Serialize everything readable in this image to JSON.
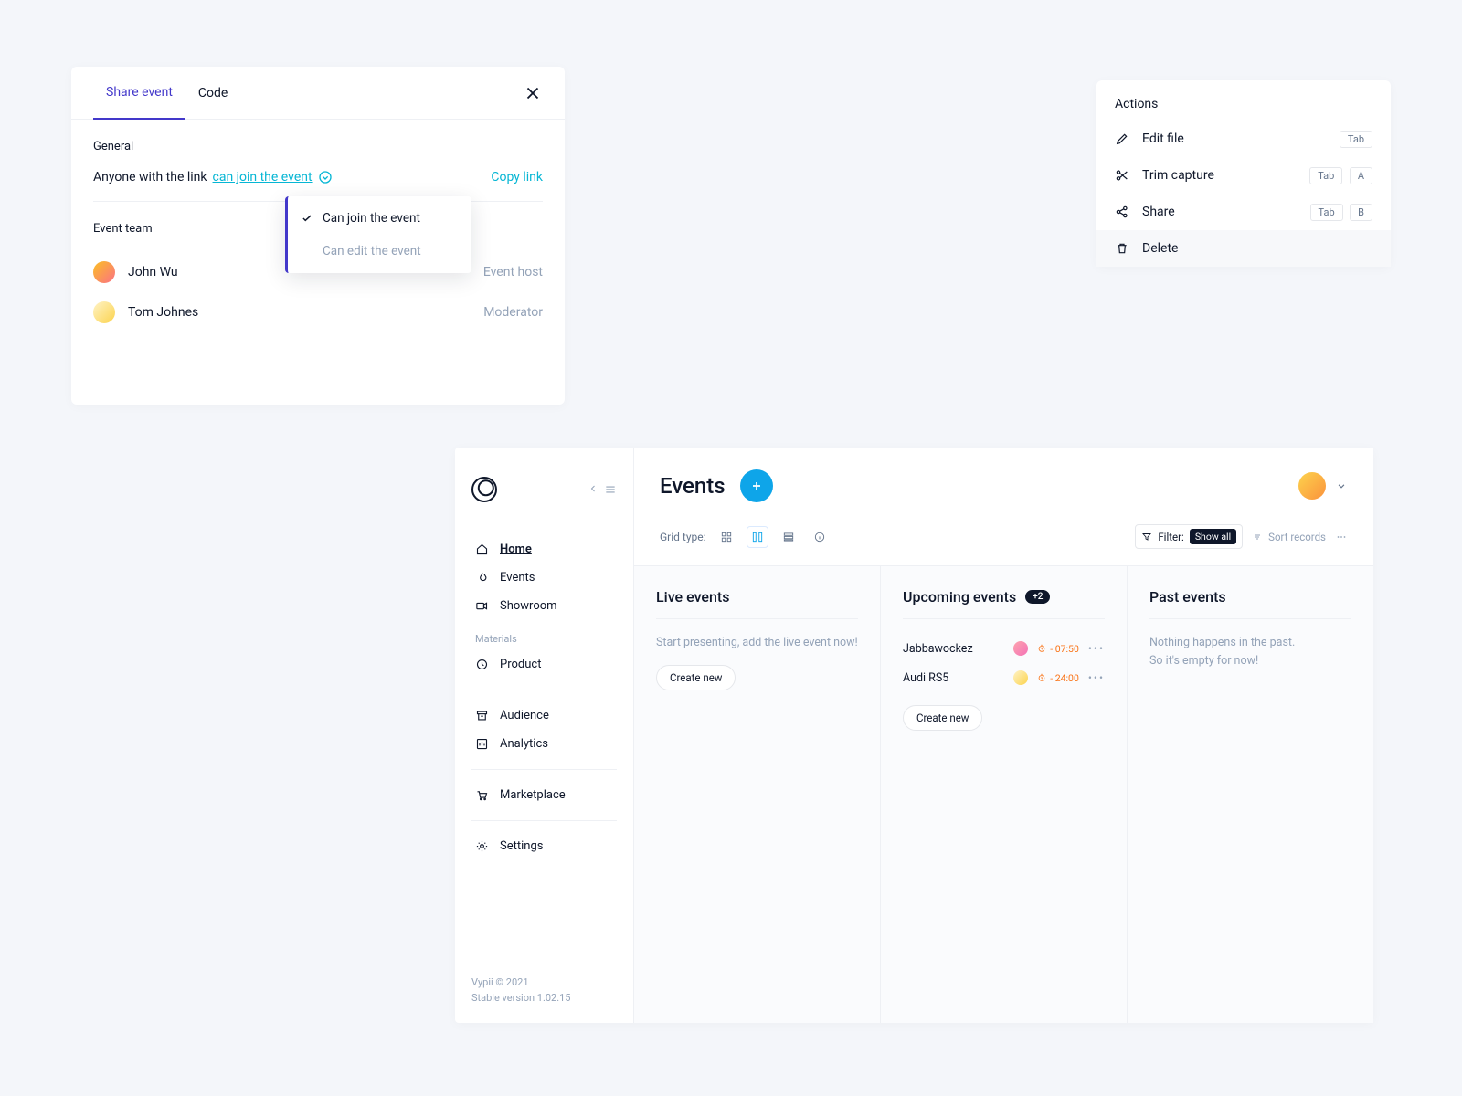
{
  "share": {
    "tabs": {
      "share": "Share event",
      "code": "Code"
    },
    "sections": {
      "general": "General",
      "team": "Event team"
    },
    "linkRow": {
      "prefix": "Anyone with the link ",
      "action": "can join the event",
      "copy": "Copy link"
    },
    "dropdown": {
      "opt1": "Can join the event",
      "opt2": "Can edit the event"
    },
    "team": [
      {
        "name": "John Wu",
        "role": "Event host"
      },
      {
        "name": "Tom Johnes",
        "role": "Moderator"
      }
    ]
  },
  "actions": {
    "title": "Actions",
    "items": {
      "edit": "Edit file",
      "trim": "Trim capture",
      "share": "Share",
      "delete": "Delete"
    },
    "kbd": {
      "tab": "Tab",
      "a": "A",
      "b": "B"
    }
  },
  "app": {
    "nav": {
      "home": "Home",
      "events": "Events",
      "showroom": "Showroom",
      "materials_label": "Materials",
      "product": "Product",
      "audience": "Audience",
      "analytics": "Analytics",
      "marketplace": "Marketplace",
      "settings": "Settings"
    },
    "footer": {
      "copyright": "Vypii © 2021",
      "version": "Stable version 1.02.15"
    },
    "header": {
      "title": "Events",
      "grid_label": "Grid type:"
    },
    "toolbar": {
      "filter_label": "Filter:",
      "filter_value": "Show all",
      "sort": "Sort records"
    },
    "columns": {
      "live": {
        "title": "Live events",
        "empty": "Start presenting, add the live event now!",
        "create": "Create new"
      },
      "upcoming": {
        "title": "Upcoming events",
        "badge": "+2",
        "create": "Create new",
        "events": [
          {
            "name": "Jabbawockez",
            "time": "- 07:50"
          },
          {
            "name": "Audi RS5",
            "time": "- 24:00"
          }
        ]
      },
      "past": {
        "title": "Past events",
        "empty1": "Nothing happens in the past.",
        "empty2": "So it's empty for now!"
      }
    }
  }
}
